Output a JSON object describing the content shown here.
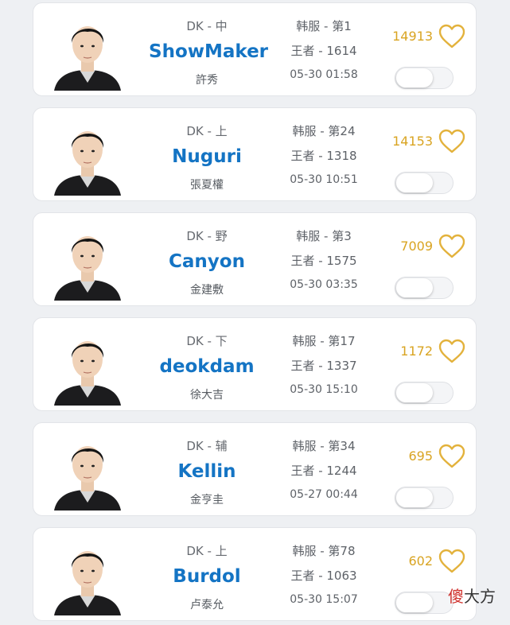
{
  "players": [
    {
      "team_role": "DK - 中",
      "name": "ShowMaker",
      "real_name": "許秀",
      "server": "韩服 - 第1",
      "tier": "王者 - 1614",
      "time": "05-30 01:58",
      "likes": "14913",
      "toggle_on": false
    },
    {
      "team_role": "DK - 上",
      "name": "Nuguri",
      "real_name": "張夏權",
      "server": "韩服 - 第24",
      "tier": "王者 - 1318",
      "time": "05-30 10:51",
      "likes": "14153",
      "toggle_on": false
    },
    {
      "team_role": "DK - 野",
      "name": "Canyon",
      "real_name": "金建敷",
      "server": "韩服 - 第3",
      "tier": "王者 - 1575",
      "time": "05-30 03:35",
      "likes": "7009",
      "toggle_on": false
    },
    {
      "team_role": "DK - 下",
      "name": "deokdam",
      "real_name": "徐大吉",
      "server": "韩服 - 第17",
      "tier": "王者 - 1337",
      "time": "05-30 15:10",
      "likes": "1172",
      "toggle_on": false
    },
    {
      "team_role": "DK - 辅",
      "name": "Kellin",
      "real_name": "金亨圭",
      "server": "韩服 - 第34",
      "tier": "王者 - 1244",
      "time": "05-27 00:44",
      "likes": "695",
      "toggle_on": false
    },
    {
      "team_role": "DK - 上",
      "name": "Burdol",
      "real_name": "卢泰允",
      "server": "韩服 - 第78",
      "tier": "王者 - 1063",
      "time": "05-30 15:07",
      "likes": "602",
      "toggle_on": false
    }
  ],
  "watermark": {
    "first": "傻",
    "rest": "大方"
  },
  "colors": {
    "name": "#1474c4",
    "likes": "#d9a422",
    "heart": "#e3b23c"
  },
  "icons": {
    "like": "heart-outline-icon",
    "avatar": "player-avatar"
  }
}
